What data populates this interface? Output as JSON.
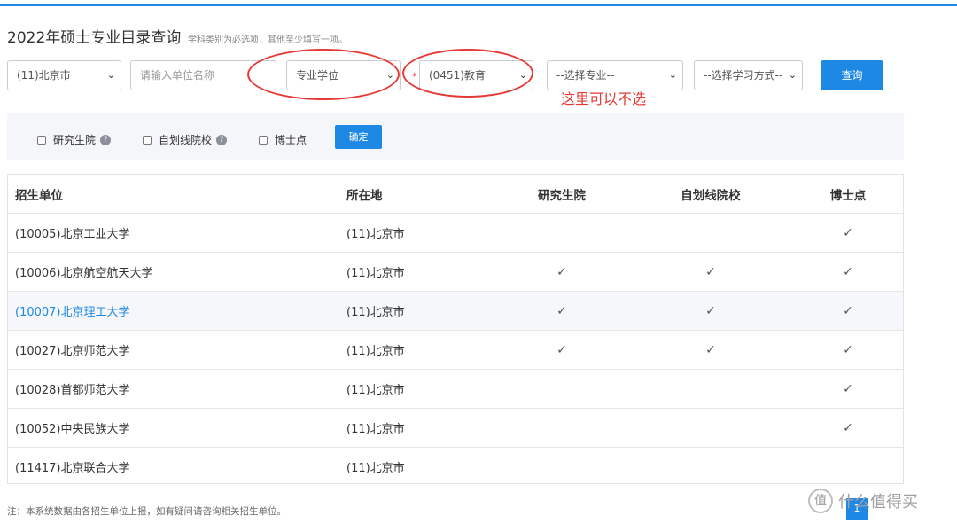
{
  "header": {
    "title": "2022年硕士专业目录查询",
    "hint": "学科类别为必选项，其他至少填写一项。"
  },
  "filters": {
    "province": "(11)北京市",
    "unit_placeholder": "请输入单位名称",
    "degree_type": "专业学位",
    "required_mark": "*",
    "discipline": "(0451)教育",
    "major": "--选择专业--",
    "study_mode": "--选择学习方式--",
    "query_button": "查询",
    "annotation": "这里可以不选"
  },
  "options": {
    "graduate_school": "研究生院",
    "self_line": "自划线院校",
    "doctoral": "博士点",
    "confirm_button": "确定"
  },
  "table": {
    "headers": [
      "招生单位",
      "所在地",
      "研究生院",
      "自划线院校",
      "博士点"
    ],
    "rows": [
      {
        "unit": "(10005)北京工业大学",
        "location": "(11)北京市",
        "graduate_school": false,
        "self_line": false,
        "doctoral": true
      },
      {
        "unit": "(10006)北京航空航天大学",
        "location": "(11)北京市",
        "graduate_school": true,
        "self_line": true,
        "doctoral": true
      },
      {
        "unit": "(10007)北京理工大学",
        "location": "(11)北京市",
        "graduate_school": true,
        "self_line": true,
        "doctoral": true,
        "highlighted": true
      },
      {
        "unit": "(10027)北京师范大学",
        "location": "(11)北京市",
        "graduate_school": true,
        "self_line": true,
        "doctoral": true
      },
      {
        "unit": "(10028)首都师范大学",
        "location": "(11)北京市",
        "graduate_school": false,
        "self_line": false,
        "doctoral": true
      },
      {
        "unit": "(10052)中央民族大学",
        "location": "(11)北京市",
        "graduate_school": false,
        "self_line": false,
        "doctoral": true
      },
      {
        "unit": "(11417)北京联合大学",
        "location": "(11)北京市",
        "graduate_school": false,
        "self_line": false,
        "doctoral": false
      }
    ]
  },
  "footer": {
    "note": "注：本系统数据由各招生单位上报，如有疑问请咨询相关招生单位。",
    "current_page": "1"
  },
  "watermark": {
    "glyph": "值",
    "text": "什么值得买"
  },
  "icons": {
    "chevron": "chevron-down-icon",
    "check": "check-icon",
    "help": "help-icon"
  },
  "colors": {
    "accent": "#1e88e5",
    "annotation": "#e53935",
    "link": "#1e88e5"
  }
}
